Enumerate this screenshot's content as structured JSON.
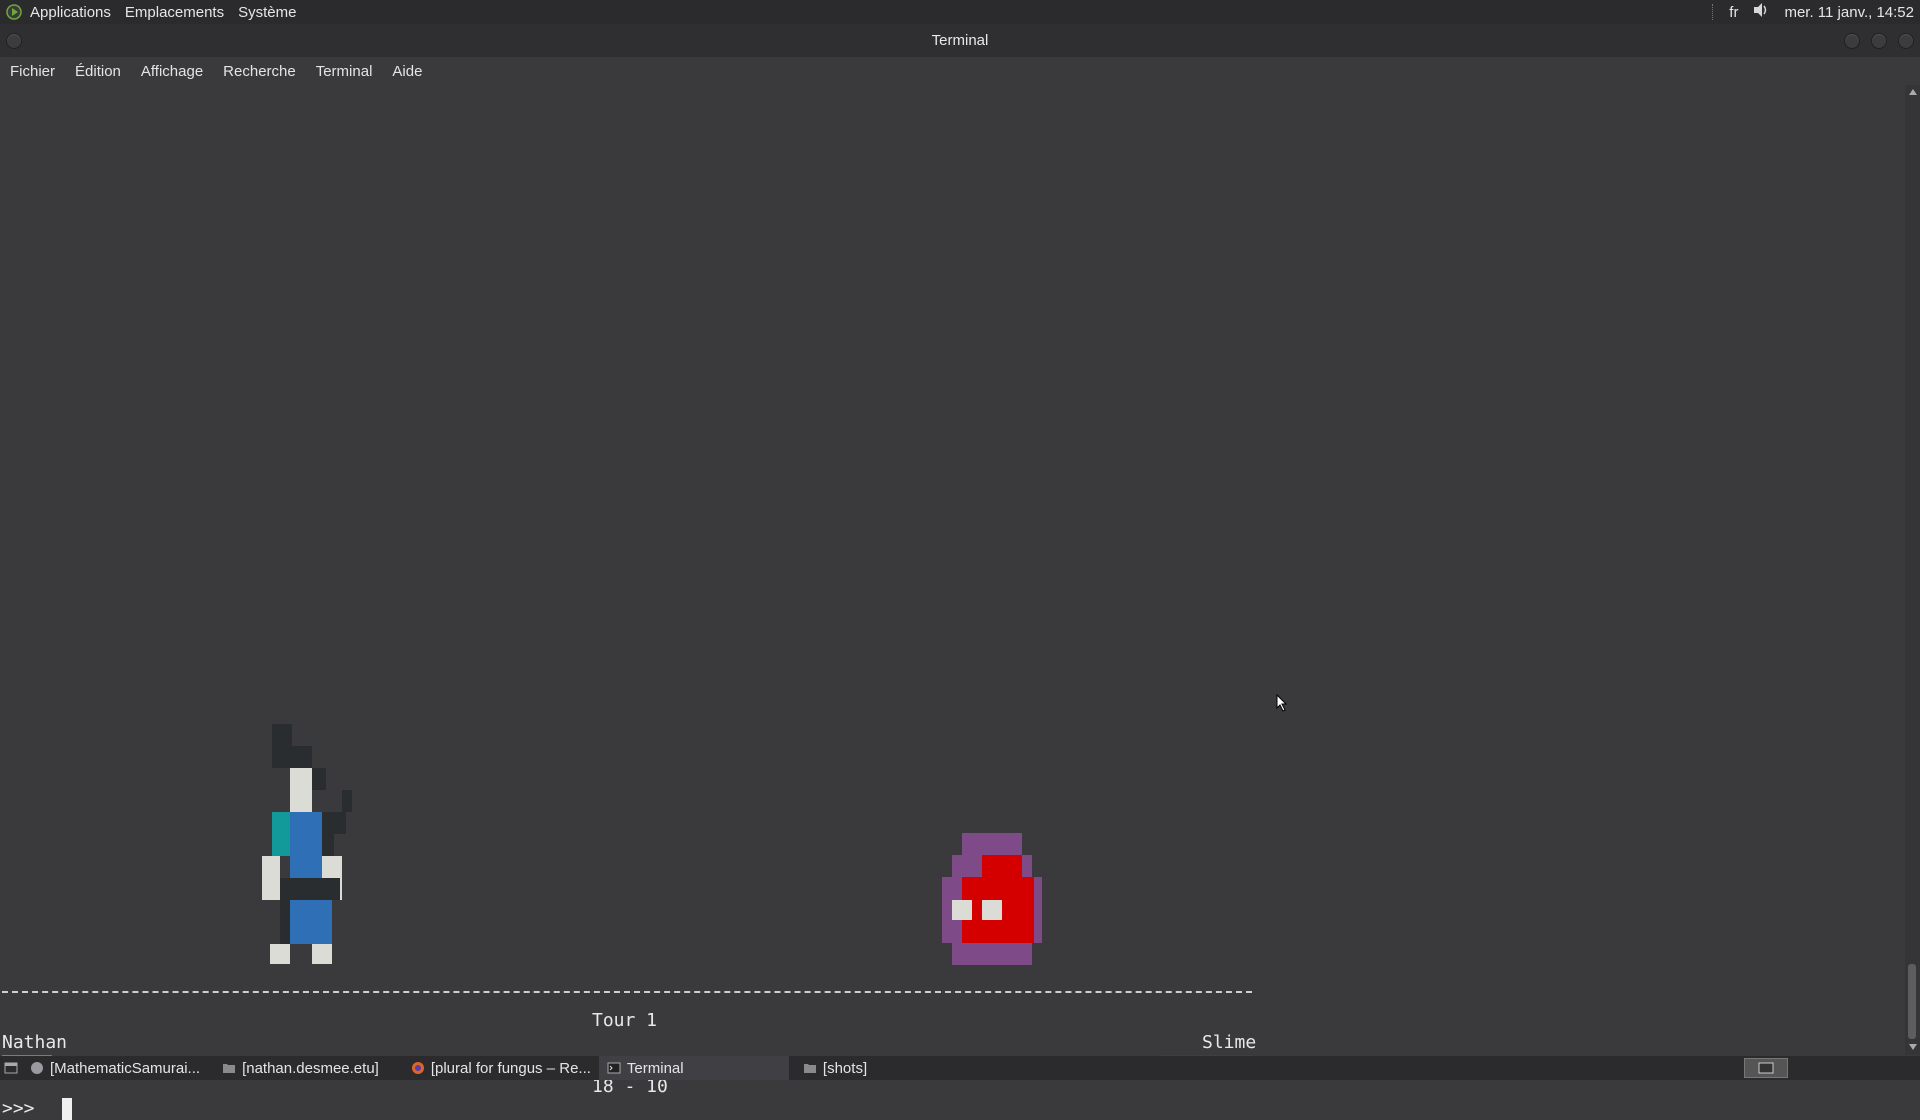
{
  "top_panel": {
    "menus": [
      "Applications",
      "Emplacements",
      "Système"
    ],
    "keyboard_layout": "fr",
    "clock": "mer. 11 janv., 14:52"
  },
  "window": {
    "title": "Terminal",
    "menu": [
      "Fichier",
      "Édition",
      "Affichage",
      "Recherche",
      "Terminal",
      "Aide"
    ]
  },
  "game": {
    "turn_label": "Tour 1",
    "player_name": "Nathan",
    "enemy_name": "Slime",
    "score": "18 - 10",
    "prompt": ">>>",
    "colors": {
      "player_hp": "#5a9e1a",
      "enemy_hp": "#d40000"
    }
  },
  "taskbar": {
    "tasks": [
      {
        "label": "[MathematicSamurai...",
        "icon": "app-icon"
      },
      {
        "label": "[nathan.desmee.etu]",
        "icon": "folder-icon"
      },
      {
        "label": "[plural for fungus – Re...",
        "icon": "firefox-icon"
      },
      {
        "label": "Terminal",
        "icon": "terminal-icon"
      },
      {
        "label": "[shots]",
        "icon": "folder-icon"
      }
    ]
  }
}
